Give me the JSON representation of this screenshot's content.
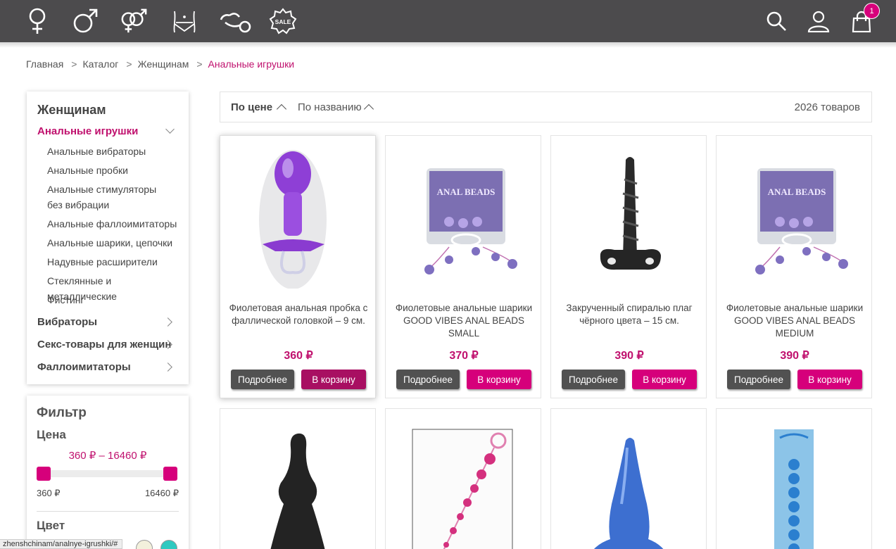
{
  "header": {
    "categories": [
      {
        "name": "women",
        "icon": "female-symbol-icon"
      },
      {
        "name": "men",
        "icon": "male-symbol-icon"
      },
      {
        "name": "couples",
        "icon": "couple-symbol-icon"
      },
      {
        "name": "lingerie",
        "icon": "lingerie-icon"
      },
      {
        "name": "bdsm",
        "icon": "handcuffs-icon"
      },
      {
        "name": "sale",
        "icon": "sale-badge-icon",
        "label": "SALE"
      }
    ],
    "cart_count": "1"
  },
  "breadcrumb": {
    "home": "Главная",
    "catalog": "Каталог",
    "women": "Женщинам",
    "current": "Анальные игрушки",
    "separator": ">"
  },
  "sidebar": {
    "title": "Женщинам",
    "active_category": "Анальные игрушки",
    "subitems": [
      "Анальные вибраторы",
      "Анальные пробки",
      "Анальные стимуляторы без вибрации",
      "Анальные фаллоимитаторы",
      "Анальные шарики, цепочки",
      "Надувные расширители",
      "Стеклянные и металлические",
      "Фистинг"
    ],
    "categories": [
      "Вибраторы",
      "Секс-товары для женщин",
      "Фаллоимитаторы"
    ]
  },
  "filter": {
    "title": "Фильтр",
    "price_title": "Цена",
    "price_range": "360 ₽ – 16460 ₽",
    "min_label": "360 ₽",
    "max_label": "16460 ₽",
    "range_fraction": [
      0,
      1
    ],
    "color_title": "Цвет",
    "colors": [
      "#f3f0dc",
      "#2fc9c0"
    ]
  },
  "status_bar": {
    "url": "zhenshchinam/analnye-igrushki/#"
  },
  "sort": {
    "by_price": "По цене",
    "by_name": "По названию",
    "count": "2026 товаров"
  },
  "buttons": {
    "more": "Подробнее",
    "cart": "В корзину"
  },
  "products": [
    {
      "title": "Фиолетовая анальная пробка с фаллической головкой – 9 см.",
      "price": "360 ₽"
    },
    {
      "title": "Фиолетовые анальные шарики GOOD VIBES ANAL BEADS SMALL",
      "price": "370 ₽"
    },
    {
      "title": "Закрученный спиралью плаг чёрного цвета – 15 см.",
      "price": "390 ₽"
    },
    {
      "title": "Фиолетовые анальные шарики GOOD VIBES ANAL BEADS MEDIUM",
      "price": "390 ₽"
    },
    {
      "title": "",
      "price": ""
    },
    {
      "title": "",
      "price": ""
    },
    {
      "title": "",
      "price": ""
    },
    {
      "title": "",
      "price": ""
    }
  ],
  "package_text": "ANAL BEADS",
  "colors": {
    "accent": "#d6007b",
    "accent_dark": "#a80f62",
    "header_bg": "#4c4b4d",
    "button_dark": "#515151",
    "price": "#c0116e"
  }
}
